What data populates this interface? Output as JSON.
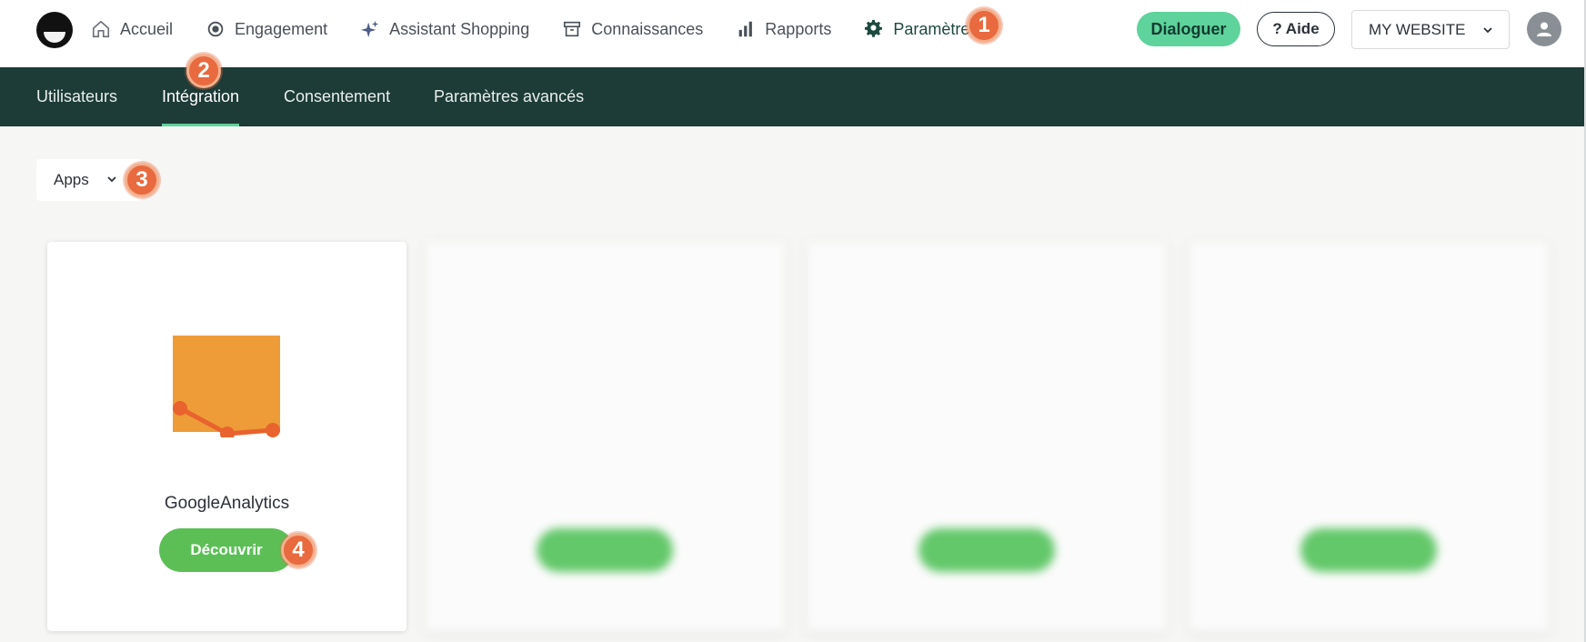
{
  "topbar": {
    "nav": [
      {
        "label": "Accueil",
        "icon": "home-icon"
      },
      {
        "label": "Engagement",
        "icon": "target-icon"
      },
      {
        "label": "Assistant Shopping",
        "icon": "sparkle-icon"
      },
      {
        "label": "Connaissances",
        "icon": "archive-icon"
      },
      {
        "label": "Rapports",
        "icon": "bar-chart-icon"
      },
      {
        "label": "Paramètres",
        "icon": "gear-icon",
        "active": true
      }
    ],
    "dialoguer_label": "Dialoguer",
    "aide_label": "? Aide",
    "website_select": "MY WEBSITE"
  },
  "subnav": {
    "items": [
      {
        "label": "Utilisateurs"
      },
      {
        "label": "Intégration",
        "active": true
      },
      {
        "label": "Consentement"
      },
      {
        "label": "Paramètres avancés"
      }
    ]
  },
  "filter": {
    "label": "Apps"
  },
  "cards": [
    {
      "name": "GoogleAnalytics",
      "button": "Découvrir"
    },
    {
      "name": "",
      "button": "",
      "blurred": true
    },
    {
      "name": "",
      "button": "",
      "blurred": true
    },
    {
      "name": "",
      "button": "",
      "blurred": true
    }
  ],
  "badges": [
    "1",
    "2",
    "3",
    "4"
  ],
  "colors": {
    "accent_green": "#5fd39c",
    "subnav_bg": "#1d3b37",
    "discover_green": "#5bbf56",
    "badge": "#e86a3e",
    "ga_orange": "#ed9c38",
    "ga_dark_orange": "#e8632e"
  }
}
